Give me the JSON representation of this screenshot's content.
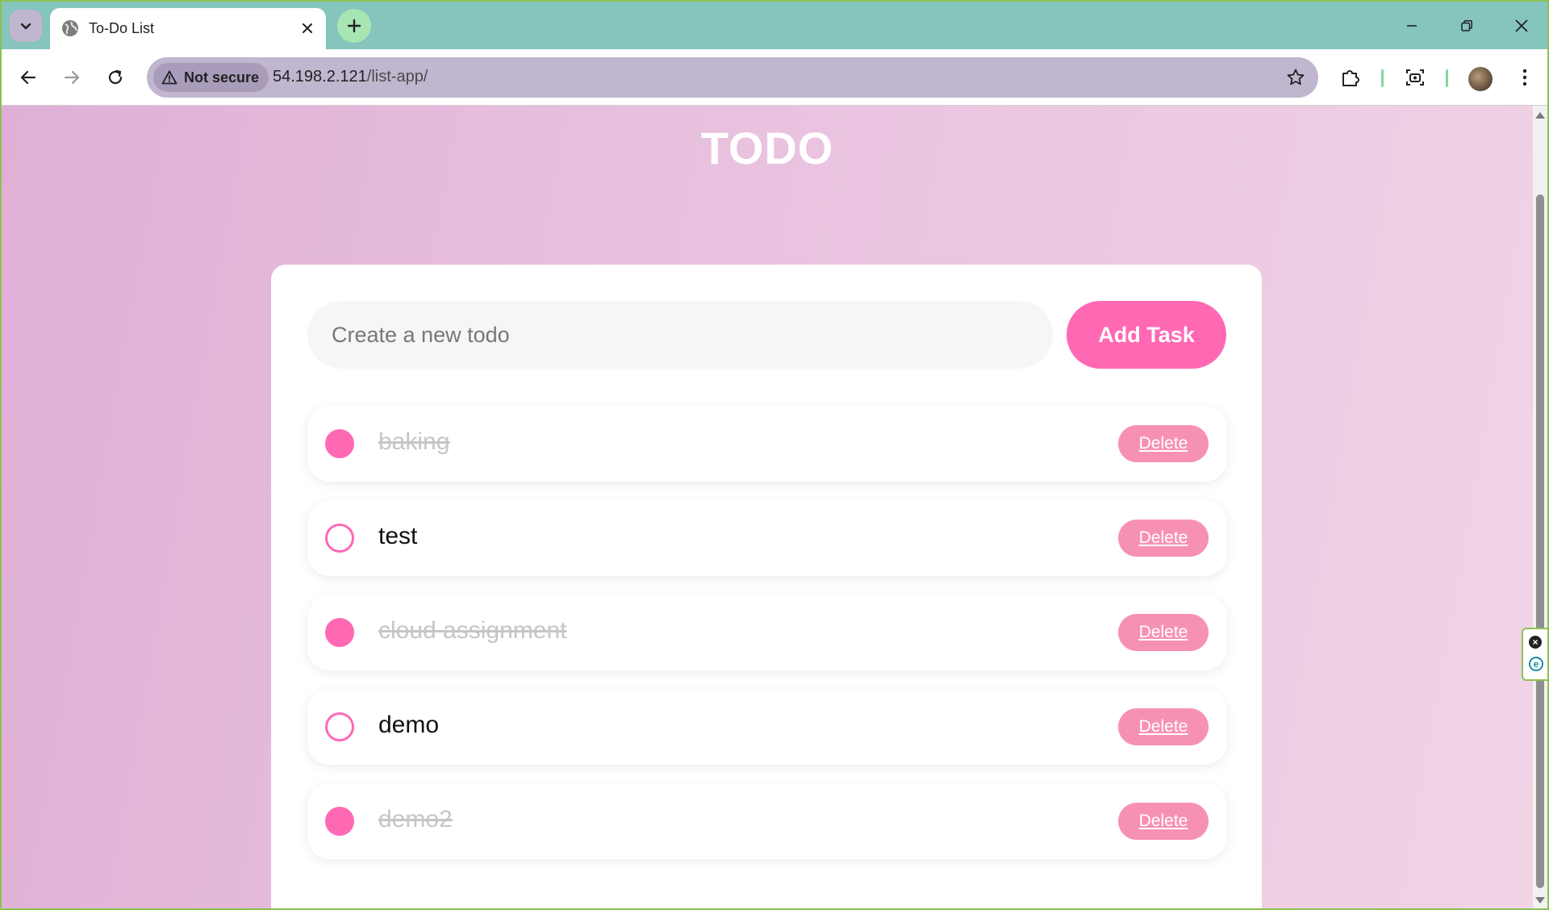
{
  "browser": {
    "tab_title": "To-Do List",
    "security_label": "Not secure",
    "url_host": "54.198.2.121",
    "url_path": "/list-app/"
  },
  "app": {
    "title": "TODO",
    "input_placeholder": "Create a new todo",
    "add_label": "Add Task",
    "delete_label": "Delete",
    "accent_color": "#ff69b4"
  },
  "todos": [
    {
      "text": "baking",
      "completed": true
    },
    {
      "text": "test",
      "completed": false
    },
    {
      "text": "cloud assignment",
      "completed": true
    },
    {
      "text": "demo",
      "completed": false
    },
    {
      "text": "demo2",
      "completed": true
    }
  ]
}
